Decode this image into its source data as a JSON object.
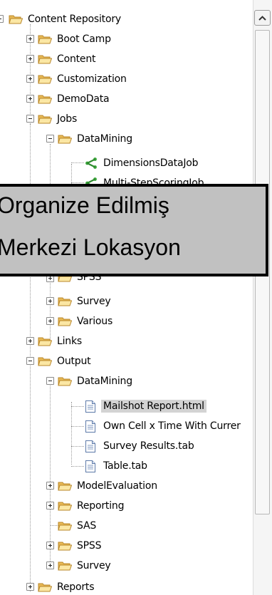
{
  "tree": {
    "root": "Content Repository",
    "content": {
      "boot_camp": "Boot Camp",
      "content": "Content",
      "customization": "Customization",
      "demodata": "DemoData",
      "jobs": "Jobs",
      "jobs_datamining": "DataMining",
      "dimensions_job": "DimensionsDataJob",
      "multistep_job": "Multi-StepScoringJob",
      "spss": "SPSS",
      "survey": "Survey",
      "various": "Various"
    },
    "links": "Links",
    "output": {
      "label": "Output",
      "datamining": "DataMining",
      "files": [
        "Mailshot Report.html",
        "Own Cell x Time With Currer",
        "Survey Results.tab",
        "Table.tab"
      ],
      "model_evaluation": "ModelEvaluation",
      "reporting": "Reporting",
      "sas": "SAS",
      "spss": "SPSS",
      "survey": "Survey"
    },
    "reports": "Reports"
  },
  "overlay": {
    "line1": "Organize Edilmiş",
    "line2": "Merkezi Lokasyon"
  }
}
